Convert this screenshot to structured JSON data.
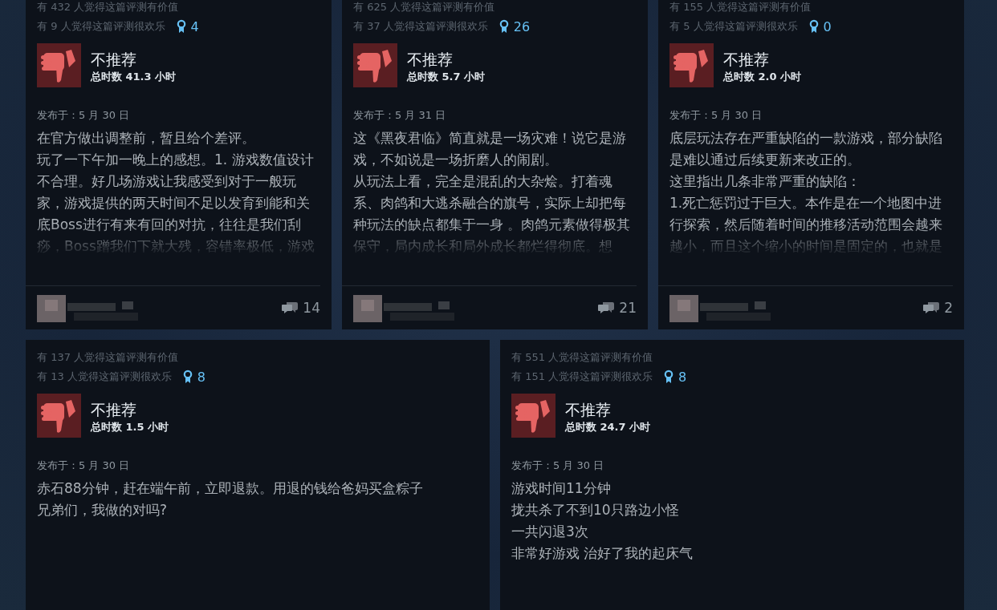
{
  "rows": [
    [
      {
        "helpful": "有 432 人觉得这篇评测有价值",
        "funny": "有 9 人觉得这篇评测很欢乐",
        "awards": "4",
        "recommended": false,
        "verdict": "不推荐",
        "hours": "总时数 41.3 小时",
        "posted": "发布于：5 月 30 日",
        "body": [
          "在官方做出调整前，暂且给个差评。",
          "玩了一下午加一晚上的感想。1. 游戏数值设计不合理。好几场游戏让我感受到对于一般玩家，游戏提供的两天时间不足以发育到能和关底Boss进行有来有回的对抗，往往是我们刮痧，Boss蹭我们下就大残，容错率极低，游戏"
        ],
        "truncated": true,
        "comments": "14"
      },
      {
        "helpful": "有 625 人觉得这篇评测有价值",
        "funny": "有 37 人觉得这篇评测很欢乐",
        "awards": "26",
        "recommended": false,
        "verdict": "不推荐",
        "hours": "总时数 5.7 小时",
        "posted": "发布于：5 月 31 日",
        "body": [
          "这《黑夜君临》简直就是一场灾难！说它是游戏，不如说是一场折磨人的闹剧。",
          "从玩法上看，完全是混乱的大杂烩。打着魂系、肉鸽和大逃杀融合的旗号，实际上却把每种玩法的缺点都集于一身 。肉鸽元素做得极其保守，局内成长和局外成长都烂得彻底。想"
        ],
        "truncated": true,
        "comments": "21"
      },
      {
        "helpful": "有 155 人觉得这篇评测有价值",
        "funny": "有 5 人觉得这篇评测很欢乐",
        "awards": "0",
        "recommended": false,
        "verdict": "不推荐",
        "hours": "总时数 2.0 小时",
        "posted": "发布于：5 月 30 日",
        "body": [
          "底层玩法存在严重缺陷的一款游戏，部分缺陷是难以通过后续更新来改正的。",
          "这里指出几条非常严重的缺陷：",
          "1.死亡惩罚过于巨大。本作是在一个地图中进行探索，然后随着时间的推移活动范围会越来越小，而且这个缩小的时间是固定的，也就是"
        ],
        "truncated": true,
        "comments": "2"
      }
    ],
    [
      {
        "helpful": "有 137 人觉得这篇评测有价值",
        "funny": "有 13 人觉得这篇评测很欢乐",
        "awards": "8",
        "recommended": false,
        "verdict": "不推荐",
        "hours": "总时数 1.5 小时",
        "posted": "发布于：5 月 30 日",
        "body": [
          "赤石88分钟，赶在端午前，立即退款。用退的钱给爸妈买盒粽子",
          "兄弟们，我做的对吗?"
        ],
        "truncated": false
      },
      {
        "helpful": "有 551 人觉得这篇评测有价值",
        "funny": "有 151 人觉得这篇评测很欢乐",
        "awards": "8",
        "recommended": false,
        "verdict": "不推荐",
        "hours": "总时数 24.7 小时",
        "posted": "发布于：5 月 30 日",
        "body": [
          "游戏时间11分钟",
          "拢共杀了不到10只路边小怪",
          "一共闪退3次",
          "非常好游戏 治好了我的起床气"
        ],
        "truncated": false
      }
    ]
  ]
}
